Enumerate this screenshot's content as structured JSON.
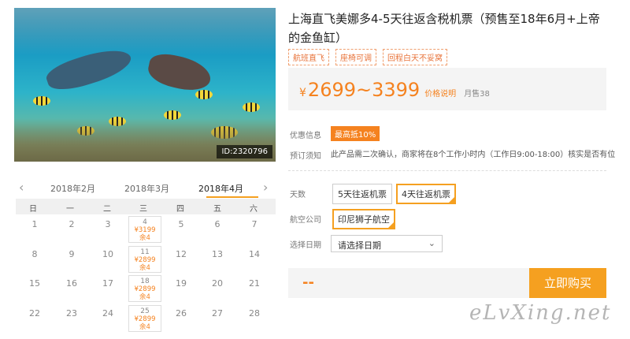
{
  "product": {
    "title": "上海直飞美娜多4-5天往返含税机票（预售至18年6月+上帝的金鱼缸）",
    "image_id": "ID:2320796",
    "tags": [
      "航班直飞",
      "座椅可调",
      "回程白天不妥窝"
    ],
    "price": {
      "currency": "¥",
      "amount": "2699~3399",
      "explain": "价格说明",
      "sold": "月售38"
    }
  },
  "info": {
    "promo_label": "优惠信息",
    "promo_badge": "最高抵10%",
    "notice_label": "预订须知",
    "notice_text": "此产品需二次确认，商家将在8个工作小时内（工作日9:00-18:00）核实是否有位"
  },
  "options": {
    "days_label": "天数",
    "days": [
      "5天往返机票",
      "4天往返机票"
    ],
    "days_selected": "4天往返机票",
    "airline_label": "航空公司",
    "airline": "印尼狮子航空",
    "date_label": "选择日期",
    "date_placeholder": "请选择日期"
  },
  "purchase": {
    "price_placeholder": "--",
    "buy_label": "立即购买"
  },
  "calendar": {
    "months": [
      "2018年2月",
      "2018年3月",
      "2018年4月"
    ],
    "active_month": "2018年4月",
    "weekdays": [
      "日",
      "一",
      "二",
      "三",
      "四",
      "五",
      "六"
    ],
    "rows": [
      [
        "1",
        "2",
        "3",
        "4",
        "5",
        "6",
        "7"
      ],
      [
        "8",
        "9",
        "10",
        "11",
        "12",
        "13",
        "14"
      ],
      [
        "15",
        "16",
        "17",
        "18",
        "19",
        "20",
        "21"
      ],
      [
        "22",
        "23",
        "24",
        "25",
        "26",
        "27",
        "28"
      ]
    ],
    "bookable": [
      {
        "day": "4",
        "price": "¥3199",
        "stock": "余4"
      },
      {
        "day": "11",
        "price": "¥2899",
        "stock": "余4"
      },
      {
        "day": "18",
        "price": "¥2899",
        "stock": "余4"
      },
      {
        "day": "25",
        "price": "¥2899",
        "stock": "余4"
      }
    ]
  },
  "watermark": "eLvXing.net",
  "colors": {
    "accent": "#f5821f",
    "selected_border": "#f5a020",
    "buy_button": "#f5a020"
  }
}
